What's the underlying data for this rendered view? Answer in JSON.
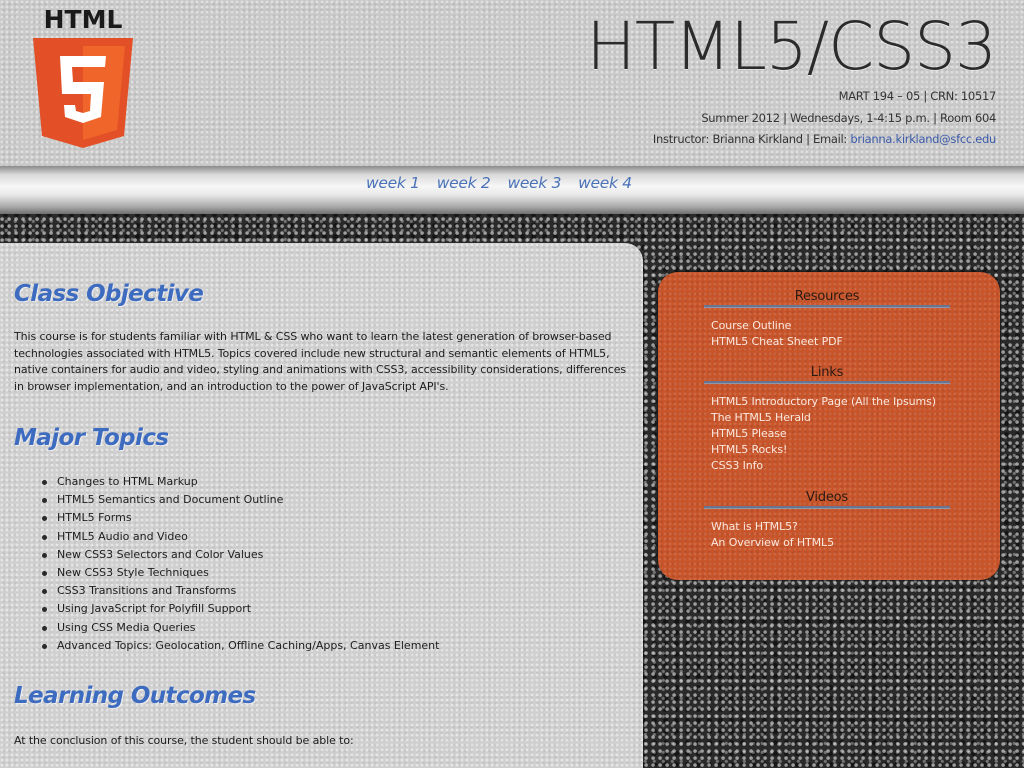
{
  "header": {
    "logo_text": "HTML",
    "logo_number": "5",
    "title": "HTML5/CSS3",
    "course_line": "MART 194 – 05 | CRN: 10517",
    "schedule_line": "Summer 2012 | Wednesdays, 1-4:15 p.m. | Room 604",
    "instructor_label": "Instructor: Brianna Kirkland | Email: ",
    "instructor_email": "brianna.kirkland@sfcc.edu"
  },
  "nav": {
    "links": [
      "week 1",
      "week 2",
      "week 3",
      "week 4"
    ]
  },
  "main": {
    "objective_heading": "Class Objective",
    "objective_text": "This course is for students familiar with HTML & CSS who want to learn the latest generation of browser-based technologies associated with HTML5. Topics covered include new structural and semantic elements of HTML5, native containers for audio and video, styling and animations with CSS3, accessibility considerations, differences in browser implementation, and an introduction to the power of JavaScript API's.",
    "topics_heading": "Major Topics",
    "topics": [
      "Changes to HTML Markup",
      "HTML5 Semantics and Document Outline",
      "HTML5 Forms",
      "HTML5 Audio and Video",
      "New CSS3 Selectors and Color Values",
      "New CSS3 Style Techniques",
      "CSS3 Transitions and Transforms",
      "Using JavaScript for Polyfill Support",
      "Using CSS Media Queries",
      "Advanced Topics: Geolocation, Offline Caching/Apps, Canvas Element"
    ],
    "outcomes_heading": "Learning Outcomes",
    "outcomes_intro": "At the conclusion of this course, the student should be able to:"
  },
  "sidebar": {
    "resources_heading": "Resources",
    "resources": [
      "Course Outline",
      "HTML5 Cheat Sheet PDF"
    ],
    "links_heading": "Links",
    "links": [
      "HTML5 Introductory Page (All the Ipsums)",
      "The HTML5 Herald",
      "HTML5 Please",
      "HTML5 Rocks!",
      "CSS3 Info"
    ],
    "videos_heading": "Videos",
    "videos": [
      "What is HTML5?",
      "An Overview of HTML5"
    ]
  },
  "colors": {
    "accent_blue": "#3d6bbf",
    "sidebar_orange": "#c8542a",
    "logo_orange": "#e34f26"
  }
}
